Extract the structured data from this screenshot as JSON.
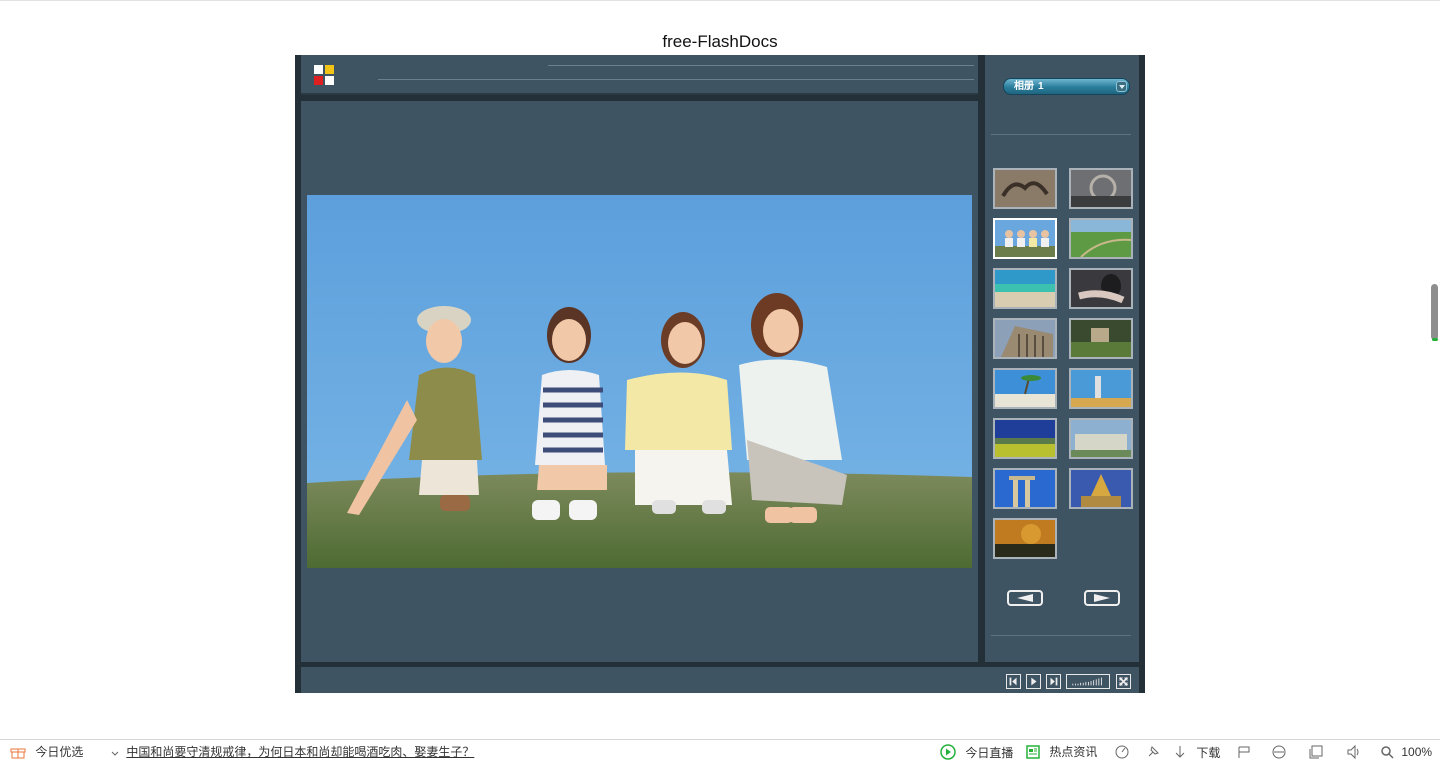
{
  "page": {
    "title": "free-FlashDocs"
  },
  "gallery": {
    "album": {
      "label": "相册",
      "number": "1"
    },
    "selected_thumbnail_index": 2,
    "thumbnail_count": 15,
    "controls": {
      "prev_label": "◄",
      "next_label": "►"
    }
  },
  "statusbar": {
    "today_pick": "今日优选",
    "news_headline": "中国和尚要守清规戒律，为何日本和尚却能喝酒吃肉、娶妻生子？",
    "live": "今日直播",
    "hot_news": "热点资讯",
    "download": "下载",
    "zoom": "100%"
  },
  "colors": {
    "panel": "#3f5463",
    "frame": "#233038",
    "album_select": "#2a7d9c",
    "live_icon": "#26b03a"
  }
}
